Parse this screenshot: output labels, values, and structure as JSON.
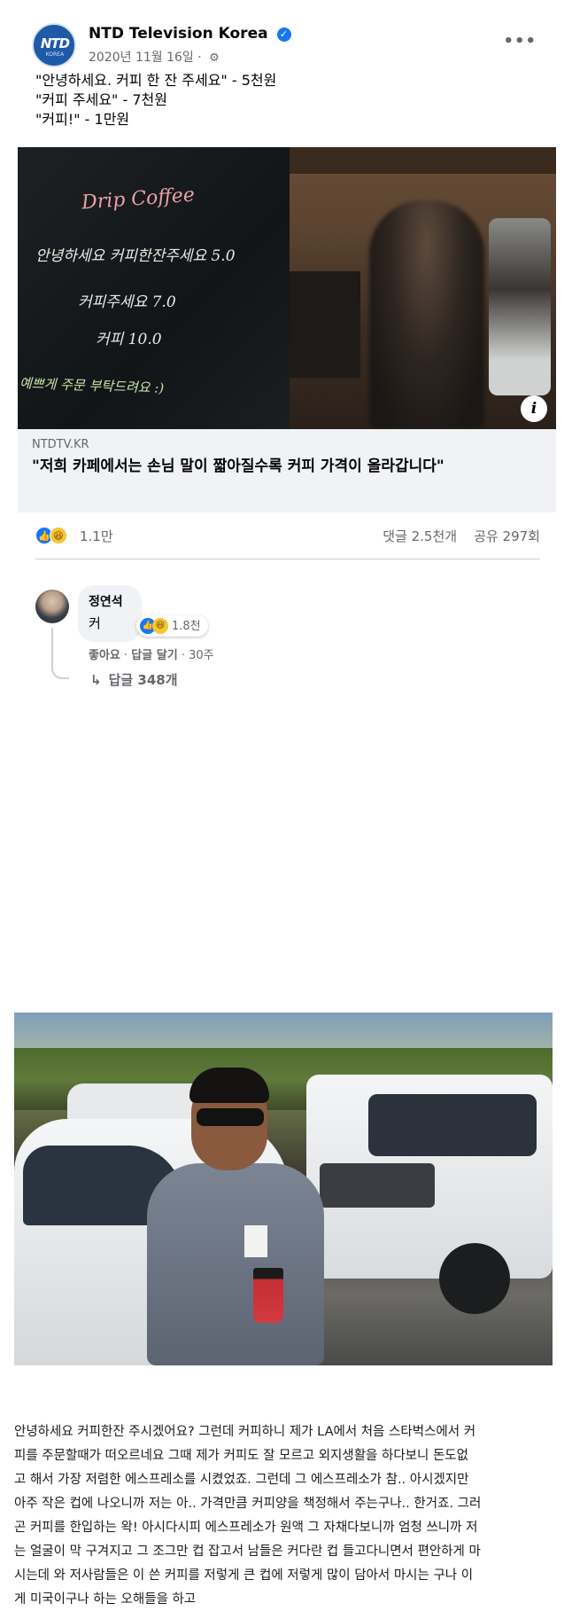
{
  "post": {
    "page_name": "NTD Television Korea",
    "verified_glyph": "✓",
    "avatar_logo": "NTD",
    "avatar_sub": "KOREA",
    "date": "2020년 11월 16일",
    "audience_icon": "gear-icon",
    "more_glyph": "•••",
    "text_lines": [
      "\"안녕하세요. 커피 한 잔 주세요\" - 5천원",
      "\"커피 주세요\" - 7천원",
      "\"커피!\" - 1만원"
    ]
  },
  "link_preview": {
    "chalkboard": {
      "title": "Drip Coffee",
      "line1": "안녕하세요 커피한잔주세요 5.0",
      "line2": "커피주세요 7.0",
      "line3": "커피 10.0",
      "line4": "예쁘게 주문 부탁드려요 :)"
    },
    "info_glyph": "i",
    "domain": "NTDTV.KR",
    "title": "\"저희 카페에서는 손님 말이 짧아질수록 커피 가격이 올라갑니다\""
  },
  "reactions": {
    "like_glyph": "👍",
    "haha_glyph": "😆",
    "count": "1.1만",
    "comments": "댓글 2.5천개",
    "shares": "공유 297회"
  },
  "comment": {
    "author": "정연석",
    "text": "커",
    "reaction_count": "1.8천",
    "like_label": "좋아요",
    "reply_label": "답글 달기",
    "time": "30주",
    "replies_label": "답글 348개",
    "reply_arrow": "↳"
  },
  "article": {
    "lines": [
      "안녕하세요 커피한잔 주시겠어요? 그런데 커피하니 제가 LA에서 처음 스타벅스에서 커",
      "피를 주문할때가 떠오르네요 그때 제가 커피도 잘 모르고 외지생활을 하다보니 돈도없",
      "고 해서 가장 저렴한 에스프레소를 시켰었죠. 그런데 그 에스프레소가 참.. 아시겠지만",
      "아주 작은 컵에 나오니까 저는 아.. 가격만큼 커피양을 책정해서 주는구나.. 한거죠. 그러",
      "곤 커피를 한입하는 왁! 아시다시피 에스프레소가 원액 그 자채다보니까 엄청 쓰니까 저",
      "는 얼굴이 막 구겨지고 그 조그만 컵 잡고서 남들은 커다란 컵 들고다니면서 편안하게 마",
      "시는데 와 저사람들은 이 쓴 커피를 저렇게 큰 컵에 저렇게 많이 담아서 마시는 구나 이",
      "게 미국이구나 하는 오해들을 하고"
    ]
  },
  "colors": {
    "brand_blue": "#1877f2",
    "meta_gray": "#65676b",
    "bubble_bg": "#f0f2f5"
  }
}
